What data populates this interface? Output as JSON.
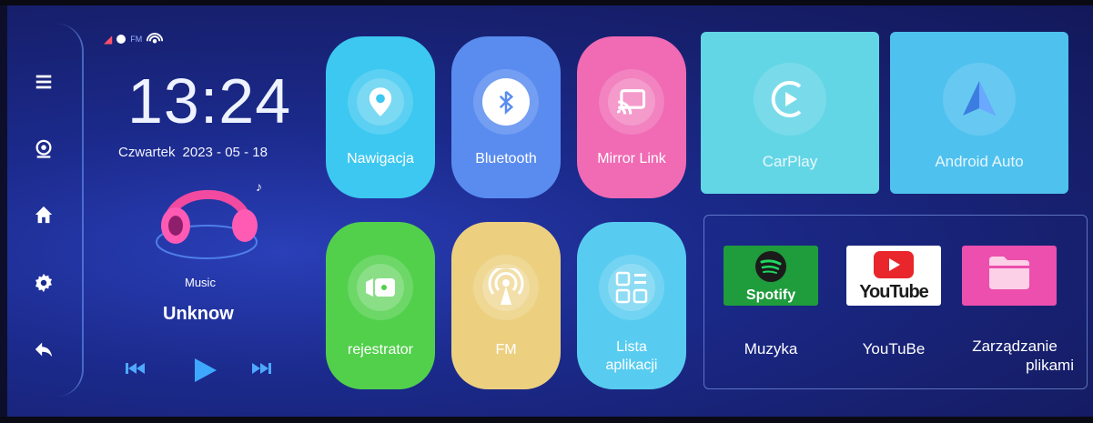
{
  "status": {
    "fm_label": "FM"
  },
  "clock": {
    "time": "13:24",
    "day": "Czwartek",
    "date": "2023 - 05 - 18"
  },
  "music": {
    "label": "Music",
    "song": "Unknow"
  },
  "tiles": [
    {
      "label": "Nawigacja",
      "color": "#3cc8f0",
      "icon": "location-pin-icon"
    },
    {
      "label": "Bluetooth",
      "color": "#5a8cf0",
      "icon": "bluetooth-phone-icon"
    },
    {
      "label": "Mirror Link",
      "color": "#f06ab4",
      "icon": "cast-icon"
    },
    {
      "label": "rejestrator",
      "color": "#52d04c",
      "icon": "camera-icon"
    },
    {
      "label": "FM",
      "color": "#ecd080",
      "icon": "radio-tower-icon"
    },
    {
      "label": "Lista\naplikacji",
      "line1": "Lista",
      "line2": "aplikacji",
      "color": "#58ccf0",
      "icon": "app-grid-icon"
    }
  ],
  "large_tiles": [
    {
      "label": "CarPlay",
      "color": "#63d6e6",
      "icon": "carplay-icon"
    },
    {
      "label": "Android Auto",
      "color": "#4fc1ef",
      "icon": "android-auto-icon"
    }
  ],
  "apps": [
    {
      "label": "Muzyka",
      "icon_text": "Spotify",
      "color": "#1f9c3c"
    },
    {
      "label": "YouTuBe",
      "icon_text": "YouTube",
      "color": "#ffffff"
    },
    {
      "label_line1": "Zarządzanie",
      "label_line2": "plikami",
      "color": "#ec4fae"
    }
  ]
}
